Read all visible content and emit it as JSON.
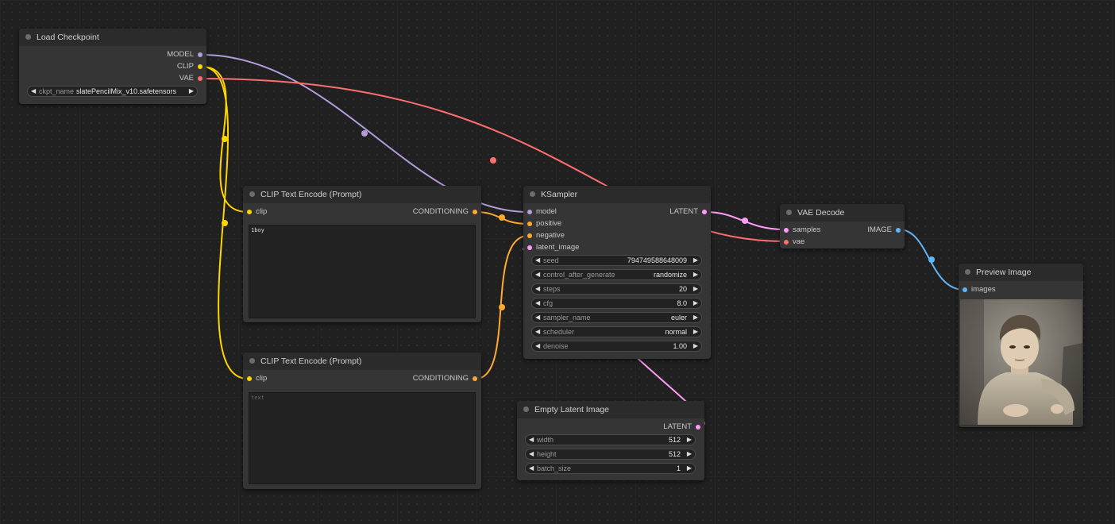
{
  "colors": {
    "model": "#b39ddb",
    "clip": "#ffd500",
    "vae": "#ff6e6e",
    "conditioning": "#ffa931",
    "latent": "#ff9cf9",
    "image": "#64b5f6"
  },
  "load_checkpoint": {
    "title": "Load Checkpoint",
    "outputs": [
      "MODEL",
      "CLIP",
      "VAE"
    ],
    "ckpt_name_label": "ckpt_name",
    "ckpt_name_value": "slatePencilMix_v10.safetensors"
  },
  "clip_encode_1": {
    "title": "CLIP Text Encode (Prompt)",
    "input": "clip",
    "output": "CONDITIONING",
    "text": "1boy"
  },
  "clip_encode_2": {
    "title": "CLIP Text Encode (Prompt)",
    "input": "clip",
    "output": "CONDITIONING",
    "placeholder": "text"
  },
  "ksampler": {
    "title": "KSampler",
    "inputs": [
      "model",
      "positive",
      "negative",
      "latent_image"
    ],
    "output": "LATENT",
    "widgets": [
      {
        "label": "seed",
        "value": "794749588648009"
      },
      {
        "label": "control_after_generate",
        "value": "randomize"
      },
      {
        "label": "steps",
        "value": "20"
      },
      {
        "label": "cfg",
        "value": "8.0"
      },
      {
        "label": "sampler_name",
        "value": "euler"
      },
      {
        "label": "scheduler",
        "value": "normal"
      },
      {
        "label": "denoise",
        "value": "1.00"
      }
    ]
  },
  "empty_latent": {
    "title": "Empty Latent Image",
    "output": "LATENT",
    "widgets": [
      {
        "label": "width",
        "value": "512"
      },
      {
        "label": "height",
        "value": "512"
      },
      {
        "label": "batch_size",
        "value": "1"
      }
    ]
  },
  "vae_decode": {
    "title": "VAE Decode",
    "inputs": [
      "samples",
      "vae"
    ],
    "output": "IMAGE"
  },
  "preview_image": {
    "title": "Preview Image",
    "input": "images"
  }
}
